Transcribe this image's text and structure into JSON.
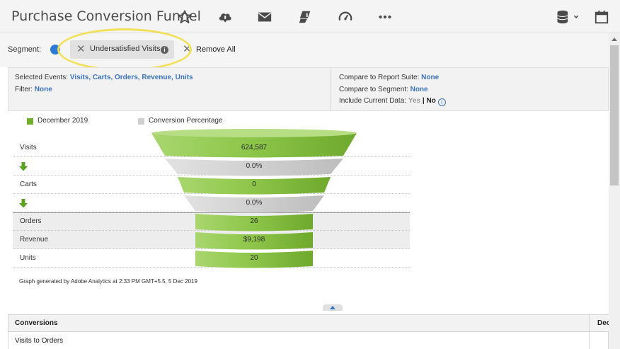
{
  "header": {
    "title": "Purchase Conversion Funnel",
    "icons": [
      "star-icon",
      "cloud-download-icon",
      "mail-icon",
      "bookmark-add-icon",
      "speedometer-icon",
      "more-icon",
      "database-dropdown-icon",
      "calendar-icon"
    ]
  },
  "segment": {
    "label": "Segment:",
    "pill_text": "Undersatisfied Visits",
    "remove_all": "Remove All"
  },
  "info": {
    "selected_events_label": "Selected Events:",
    "selected_events_value": "Visits, Carts, Orders, Revenue, Units",
    "filter_label": "Filter:",
    "filter_value": "None",
    "compare_suite_label": "Compare to Report Suite:",
    "compare_suite_value": "None",
    "compare_segment_label": "Compare to Segment:",
    "compare_segment_value": "None",
    "include_current_label": "Include Current Data:",
    "include_yes": "Yes",
    "include_sep": "|",
    "include_no": "No",
    "info_glyph": "i"
  },
  "chart_data": {
    "type": "funnel",
    "legend": [
      {
        "label": "December 2019",
        "color": "#6faf2a"
      },
      {
        "label": "Conversion Percentage",
        "color": "#cfcfcf"
      }
    ],
    "rows": [
      {
        "label": "Visits",
        "kind": "metric",
        "value_text": "624,587"
      },
      {
        "label": "",
        "kind": "conversion",
        "value_text": "0.0%"
      },
      {
        "label": "Carts",
        "kind": "metric",
        "value_text": "0"
      },
      {
        "label": "",
        "kind": "conversion",
        "value_text": "0.0%"
      },
      {
        "label": "Orders",
        "kind": "metric",
        "value_text": "26"
      },
      {
        "label": "Revenue",
        "kind": "metric",
        "value_text": "$9,198"
      },
      {
        "label": "Units",
        "kind": "metric",
        "value_text": "20"
      }
    ],
    "footnote": "Graph generated by Adobe Analytics at   2:33 PM GMT+5.5,  5 Dec 2019"
  },
  "table": {
    "header_conversions": "Conversions",
    "header_date": "Dec",
    "row1": "Visits to Orders"
  },
  "colors": {
    "accent_blue": "#3c74c0",
    "funnel_green": "#7cbb3c",
    "funnel_gray": "#cfcfcf",
    "highlight_yellow": "#f0e05a"
  }
}
